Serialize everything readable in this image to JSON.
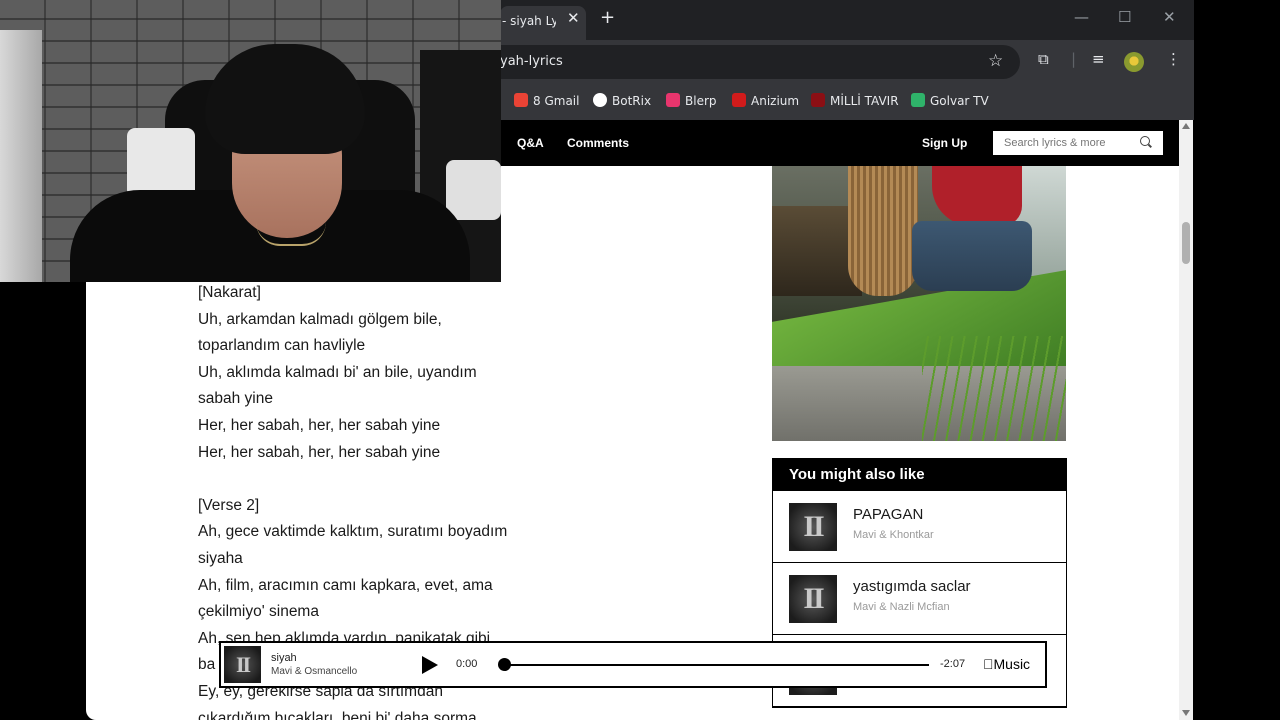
{
  "browser": {
    "tab_title": "- siyah Lyri",
    "tab_close_glyph": "✕",
    "new_tab_glyph": "+",
    "window": {
      "minimize": "—",
      "maximize": "☐",
      "close": "✕"
    },
    "url": "yah-lyrics",
    "bookmarks": [
      {
        "label": "8 Gmail",
        "color": "#ea4335"
      },
      {
        "label": "BotRix",
        "color": "#ffffff"
      },
      {
        "label": "Blerp",
        "color": "#e8356d"
      },
      {
        "label": "Anizium",
        "color": "#d11b1b"
      },
      {
        "label": "MİLLİ TAVIR",
        "color": "#8b0f14"
      },
      {
        "label": "Golvar TV",
        "color": "#2fb36a"
      }
    ]
  },
  "site_nav": {
    "qa": "Q&A",
    "comments": "Comments",
    "signup": "Sign Up",
    "search_placeholder": "Search lyrics & more"
  },
  "lyrics": [
    "[Nakarat]",
    "Uh, arkamdan kalmadı gölgem bile,",
    "toparlandım can havliyle",
    "Uh, aklımda kalmadı bi' an bile, uyandım",
    "sabah yine",
    "Her, her sabah, her, her sabah yine",
    "Her, her sabah, her, her sabah yine",
    "",
    "[Verse 2]",
    "Ah, gece vaktimde kalktım, suratımı boyadım",
    "siyaha",
    "Ah, film, aracımın camı kapkara, evet, ama",
    "çekilmiyo' sinema",
    "Ah, sen hep aklımda vardın, panikatak gibi",
    "ba",
    "Ey, ey, gerekirse sapla da sırtımdan",
    "çıkardığım bıçakları, beni bi' daha sorma"
  ],
  "you_might_also_like": {
    "heading": "You might also like",
    "items": [
      {
        "title": "PAPAGAN",
        "artist": "Mavi & Khontkar",
        "thumb_text": "II"
      },
      {
        "title": "yastıgımda saclar",
        "artist": "Mavi & Nazli Mcfian",
        "thumb_text": "II"
      },
      {
        "title": "",
        "artist": "",
        "thumb_text": "II"
      }
    ]
  },
  "player": {
    "title": "siyah",
    "artist": "Mavi & Osmancello",
    "thumb_text": "II",
    "elapsed": "0:00",
    "remaining": "-2:07",
    "brand": "Music",
    "progress": 0
  }
}
